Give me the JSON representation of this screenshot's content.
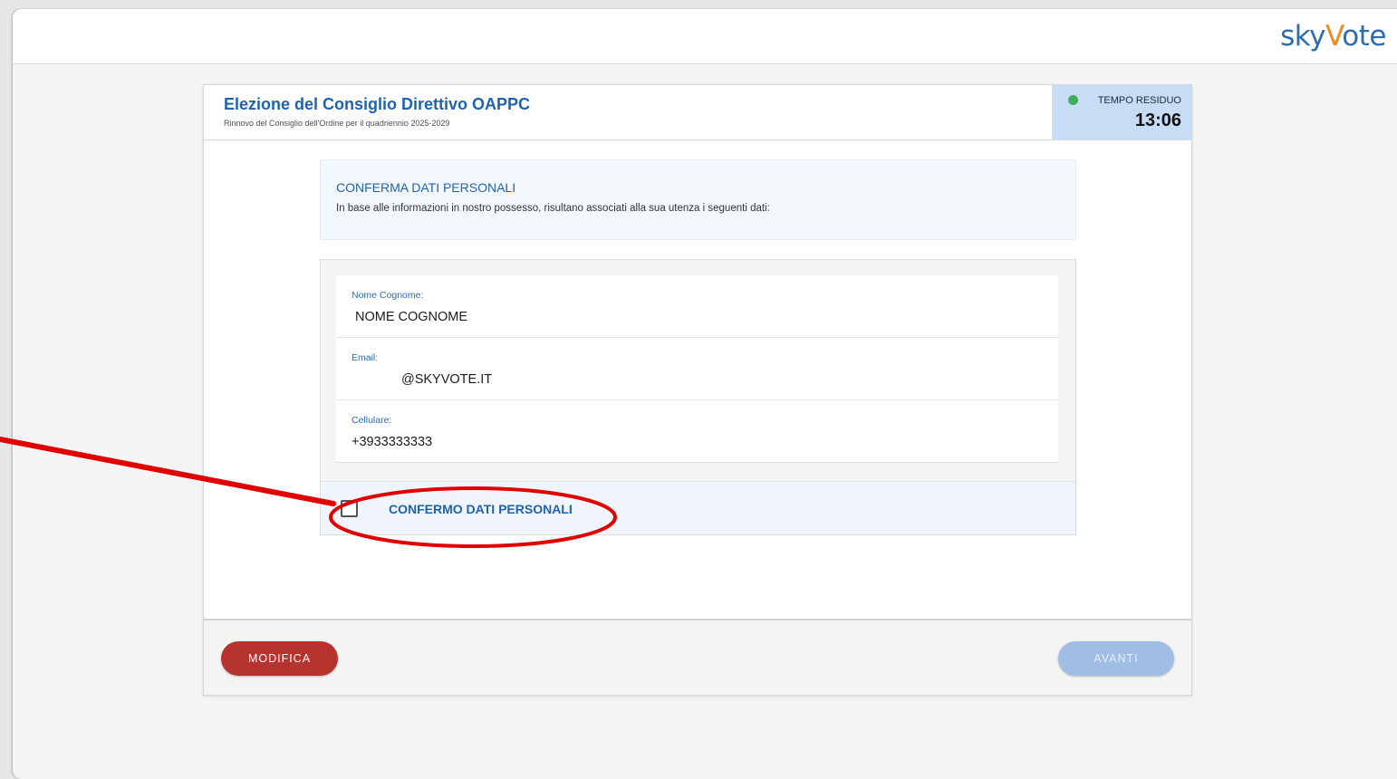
{
  "brand": {
    "logo_part1": "sky",
    "logo_part2": "V",
    "logo_part3": "ote"
  },
  "election": {
    "title": "Elezione del Consiglio Direttivo OAPPC",
    "subtitle": "Rinnovo del Consiglio dell'Ordine per il quadriennio 2025-2029"
  },
  "timer": {
    "label": "TEMPO RESIDUO",
    "value": "13:06",
    "status_color": "#3eae5a"
  },
  "info": {
    "title": "CONFERMA DATI PERSONALI",
    "text": "In base alle informazioni in nostro possesso, risultano associati alla sua utenza i seguenti dati:"
  },
  "fields": [
    {
      "label": "Nome Cognome:",
      "value": "NOME COGNOME"
    },
    {
      "label": "Email:",
      "value": "@SKYVOTE.IT"
    },
    {
      "label": "Cellulare:",
      "value": "+3933333333"
    }
  ],
  "confirm": {
    "label": "CONFERMO DATI PERSONALI",
    "checked": false
  },
  "buttons": {
    "modifica": "MODIFICA",
    "avanti": "AVANTI"
  },
  "colors": {
    "primary": "#1f62ae",
    "danger": "#b7332e",
    "disabled": "#9fbde5",
    "annotation": "#e00000"
  }
}
